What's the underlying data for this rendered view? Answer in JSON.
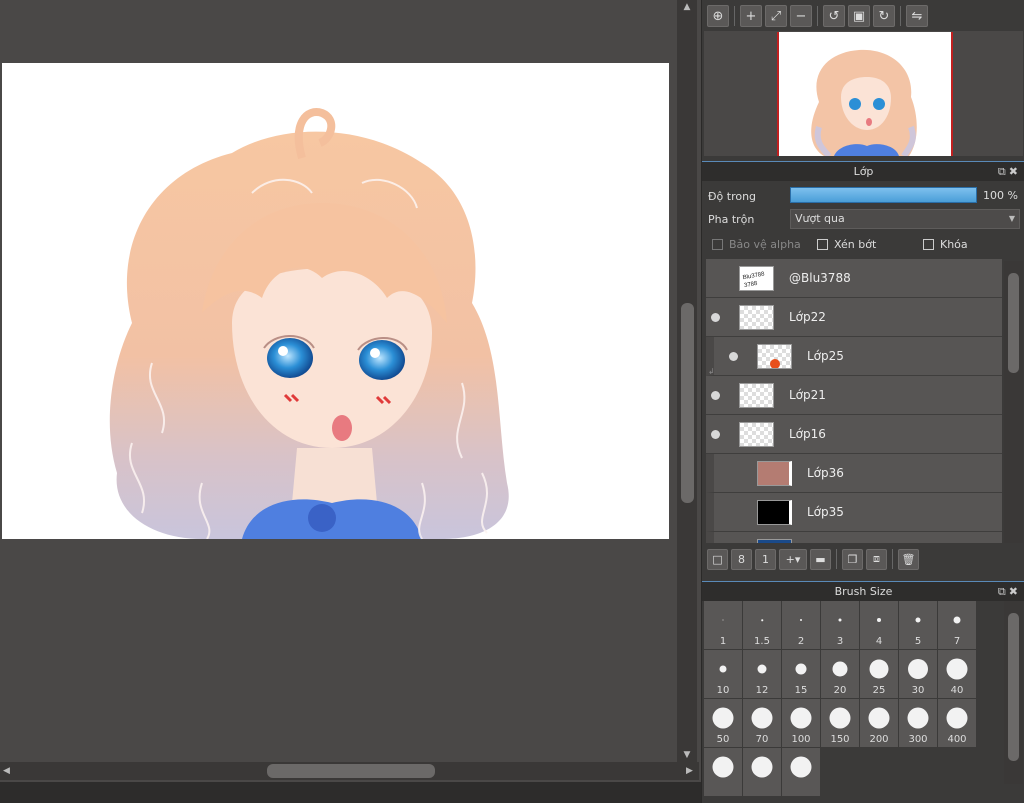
{
  "canvas": {
    "artwork": "chibi-girl-drawing"
  },
  "navigator": {
    "tools": [
      "zoom-reset-icon",
      "zoom-in-icon",
      "fit-icon",
      "zoom-out-icon",
      "rotate-left-icon",
      "fullscreen-icon",
      "rotate-right-icon",
      "flip-icon"
    ]
  },
  "layer_panel": {
    "title": "Lớp",
    "opacity_label": "Độ trong",
    "opacity_value": "100 %",
    "blend_label": "Pha trộn",
    "blend_value": "Vượt qua",
    "protect_alpha": "Bảo vệ alpha",
    "clipping": "Xén bớt",
    "lock": "Khóa",
    "layers": [
      {
        "name": "@Blu3788"
      },
      {
        "name": "Lớp22"
      },
      {
        "name": "Lớp25"
      },
      {
        "name": "Lớp21"
      },
      {
        "name": "Lớp16"
      },
      {
        "name": "Lớp36"
      },
      {
        "name": "Lớp35"
      }
    ]
  },
  "brush_panel": {
    "title": "Brush Size",
    "sizes": [
      "1",
      "1.5",
      "2",
      "3",
      "4",
      "5",
      "7",
      "10",
      "12",
      "15",
      "20",
      "25",
      "30",
      "40",
      "50",
      "70",
      "100",
      "150",
      "200",
      "300",
      "400",
      "",
      "",
      ""
    ]
  }
}
